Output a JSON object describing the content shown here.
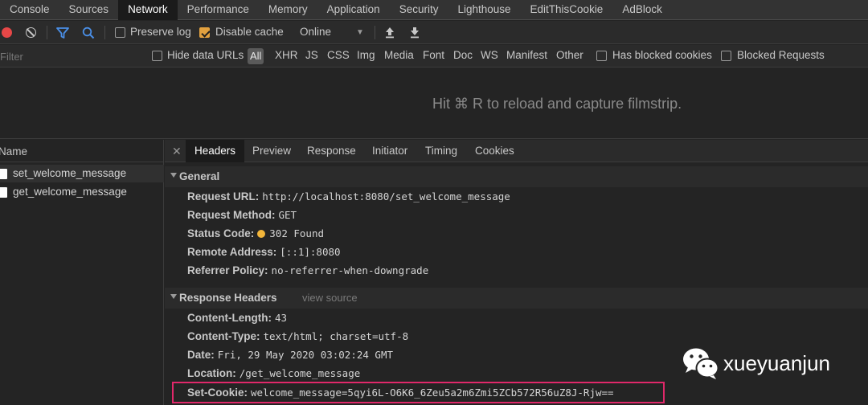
{
  "top_tabs": [
    "Console",
    "Sources",
    "Network",
    "Performance",
    "Memory",
    "Application",
    "Security",
    "Lighthouse",
    "EditThisCookie",
    "AdBlock"
  ],
  "active_top_tab": "Network",
  "toolbar": {
    "preserve_log": "Preserve log",
    "preserve_log_checked": false,
    "disable_cache": "Disable cache",
    "disable_cache_checked": true,
    "throttling": "Online"
  },
  "filter_row": {
    "placeholder": "Filter",
    "hide_data_urls": "Hide data URLs",
    "types": [
      "All",
      "XHR",
      "JS",
      "CSS",
      "Img",
      "Media",
      "Font",
      "Doc",
      "WS",
      "Manifest",
      "Other"
    ],
    "has_blocked_cookies": "Has blocked cookies",
    "blocked_requests": "Blocked Requests"
  },
  "filmstrip_message": "Hit ⌘ R to reload and capture filmstrip.",
  "requests": {
    "header": "Name",
    "items": [
      "set_welcome_message",
      "get_welcome_message"
    ]
  },
  "detail_tabs": [
    "Headers",
    "Preview",
    "Response",
    "Initiator",
    "Timing",
    "Cookies"
  ],
  "active_detail_tab": "Headers",
  "general": {
    "title": "General",
    "rows": [
      {
        "key": "Request URL:",
        "value": "http://localhost:8080/set_welcome_message"
      },
      {
        "key": "Request Method:",
        "value": "GET"
      },
      {
        "key": "Status Code:",
        "value": "302 Found"
      },
      {
        "key": "Remote Address:",
        "value": "[::1]:8080"
      },
      {
        "key": "Referrer Policy:",
        "value": "no-referrer-when-downgrade"
      }
    ]
  },
  "response_headers": {
    "title": "Response Headers",
    "view_source": "view source",
    "rows": [
      {
        "key": "Content-Length:",
        "value": "43"
      },
      {
        "key": "Content-Type:",
        "value": "text/html; charset=utf-8"
      },
      {
        "key": "Date:",
        "value": "Fri, 29 May 2020 03:02:24 GMT"
      },
      {
        "key": "Location:",
        "value": "/get_welcome_message"
      },
      {
        "key": "Set-Cookie:",
        "value": "welcome_message=5qyi6L-O6K6_6Zeu5a2m6Zmi5ZCb572R56uZ8J-Rjw=="
      }
    ]
  },
  "watermark": "xueyuanjun",
  "colors": {
    "record": "#e64747",
    "status_dot": "#f2b53a",
    "highlight_border": "#e0286a",
    "checkbox_checked": "#e2a13f"
  }
}
